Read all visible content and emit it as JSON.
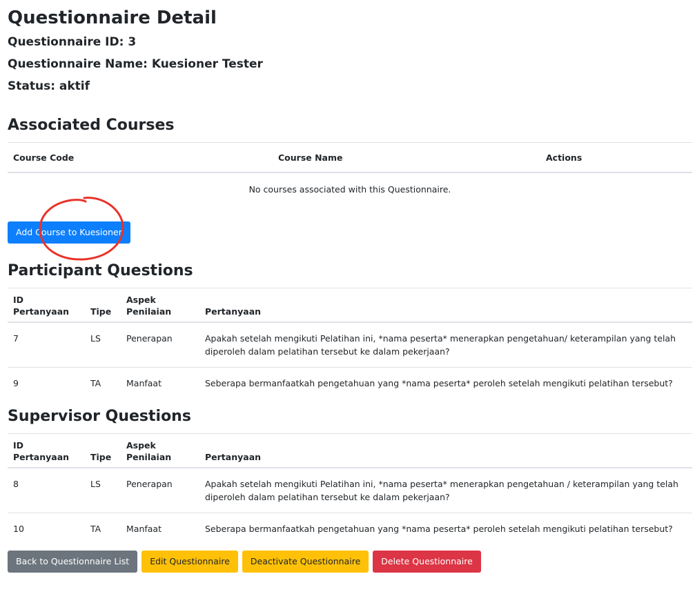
{
  "header": {
    "title": "Questionnaire Detail",
    "id_line": "Questionnaire ID: 3",
    "name_line": "Questionnaire Name: Kuesioner Tester",
    "status_line": "Status: aktif"
  },
  "courses": {
    "title": "Associated Courses",
    "columns": [
      "Course Code",
      "Course Name",
      "Actions"
    ],
    "empty_message": "No courses associated with this Questionnaire.",
    "add_button": "Add Course to Kuesioner"
  },
  "participant": {
    "title": "Participant Questions",
    "columns": {
      "id_line1": "ID",
      "id_line2": "Pertanyaan",
      "tipe": "Tipe",
      "aspek_line1": "Aspek",
      "aspek_line2": "Penilaian",
      "pertanyaan": "Pertanyaan"
    },
    "rows": [
      {
        "id": "7",
        "tipe": "LS",
        "aspek": "Penerapan",
        "pertanyaan": "Apakah setelah mengikuti Pelatihan ini, *nama peserta* menerapkan pengetahuan/ keterampilan yang telah diperoleh dalam pelatihan tersebut ke dalam pekerjaan?"
      },
      {
        "id": "9",
        "tipe": "TA",
        "aspek": "Manfaat",
        "pertanyaan": "Seberapa bermanfaatkah pengetahuan yang *nama peserta* peroleh setelah mengikuti pelatihan tersebut?"
      }
    ]
  },
  "supervisor": {
    "title": "Supervisor Questions",
    "columns": {
      "id_line1": "ID",
      "id_line2": "Pertanyaan",
      "tipe": "Tipe",
      "aspek_line1": "Aspek",
      "aspek_line2": "Penilaian",
      "pertanyaan": "Pertanyaan"
    },
    "rows": [
      {
        "id": "8",
        "tipe": "LS",
        "aspek": "Penerapan",
        "pertanyaan": "Apakah setelah mengikuti Pelatihan ini, *nama peserta* menerapkan pengetahuan / keterampilan yang telah diperoleh dalam pelatihan tersebut ke dalam pekerjaan?"
      },
      {
        "id": "10",
        "tipe": "TA",
        "aspek": "Manfaat",
        "pertanyaan": "Seberapa bermanfaatkah pengetahuan yang *nama peserta* peroleh setelah mengikuti pelatihan tersebut?"
      }
    ]
  },
  "footer": {
    "back_button": "Back to Questionnaire List",
    "edit_button": "Edit Questionnaire",
    "deactivate_button": "Deactivate Questionnaire",
    "delete_button": "Delete Questionnaire"
  },
  "colors": {
    "primary": "#0d7ffd",
    "secondary": "#6c757d",
    "warning": "#ffc107",
    "danger": "#dc3545",
    "annotation": "#e8332a"
  }
}
